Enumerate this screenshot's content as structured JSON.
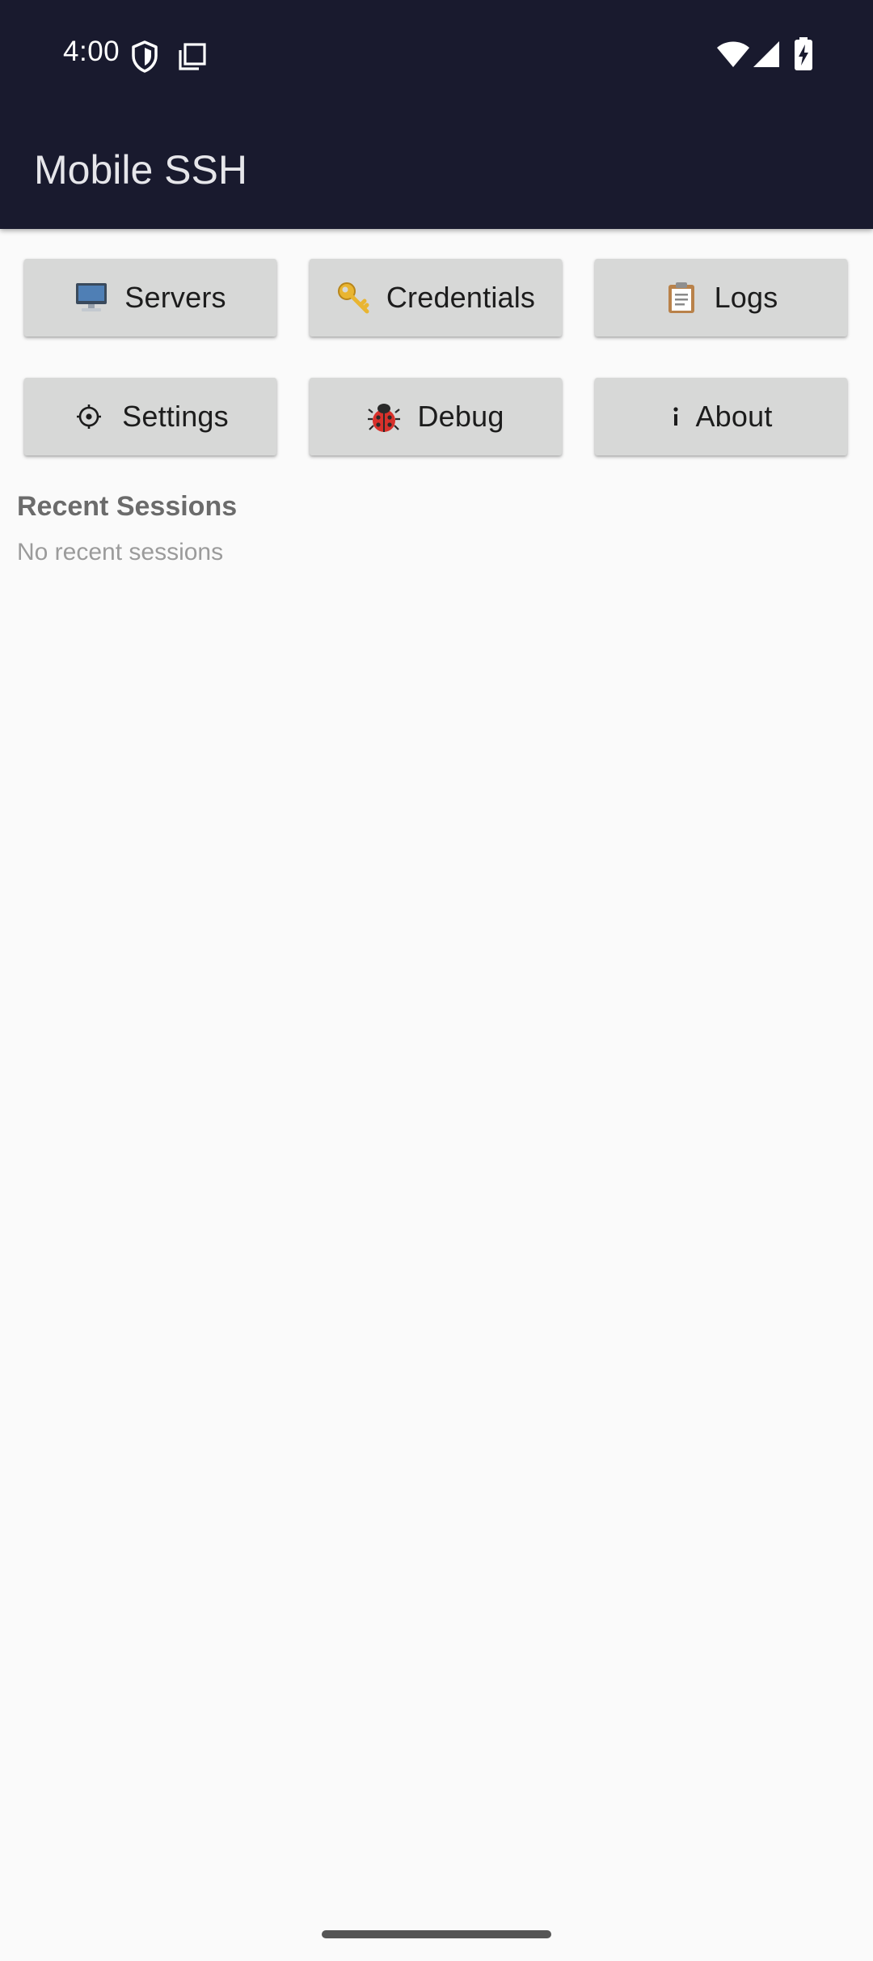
{
  "status_bar": {
    "time": "4:00",
    "left_icons": [
      "shield-icon",
      "screenshot-icon"
    ],
    "right_icons": [
      "wifi-icon",
      "cell-signal-icon",
      "battery-charging-icon"
    ]
  },
  "app_bar": {
    "title": "Mobile SSH",
    "background": "#191a2e"
  },
  "menu_buttons": [
    {
      "icon": "desktop-computer-icon",
      "label": "Servers"
    },
    {
      "icon": "key-icon",
      "label": "Credentials"
    },
    {
      "icon": "clipboard-icon",
      "label": "Logs"
    },
    {
      "icon": "gear-icon",
      "label": "Settings"
    },
    {
      "icon": "ladybug-icon",
      "label": "Debug"
    },
    {
      "icon": "info-icon",
      "label": "About"
    }
  ],
  "recent_sessions": {
    "title": "Recent Sessions",
    "empty_text": "No recent sessions"
  },
  "colors": {
    "button_background": "#d7d8d7",
    "page_background": "#fafafa"
  }
}
